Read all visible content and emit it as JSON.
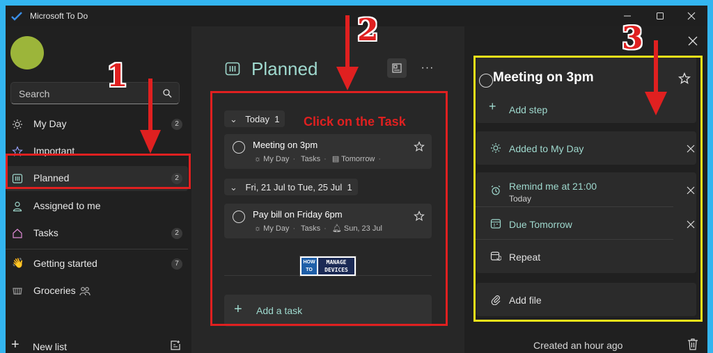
{
  "app": {
    "title": "Microsoft To Do"
  },
  "sidebar": {
    "search_placeholder": "Search",
    "items": [
      {
        "label": "My Day",
        "count": "2",
        "icon": "sun-icon"
      },
      {
        "label": "Important",
        "count": "",
        "icon": "star-icon"
      },
      {
        "label": "Planned",
        "count": "2",
        "icon": "calendar-grid-icon"
      },
      {
        "label": "Assigned to me",
        "count": "",
        "icon": "person-icon"
      },
      {
        "label": "Tasks",
        "count": "2",
        "icon": "home-icon"
      },
      {
        "label": "Getting started",
        "count": "7",
        "icon": "waving-hand-icon"
      },
      {
        "label": "Groceries",
        "count": "",
        "icon": "grocery-icon"
      }
    ],
    "new_list_label": "New list"
  },
  "main": {
    "title": "Planned",
    "groups": [
      {
        "label": "Today",
        "count": "1",
        "tasks": [
          {
            "title": "Meeting on 3pm",
            "meta": [
              "My Day",
              "Tasks",
              "Tomorrow"
            ]
          }
        ]
      },
      {
        "label": "Fri, 21 Jul to Tue, 25 Jul",
        "count": "1",
        "tasks": [
          {
            "title": "Pay bill on Friday 6pm",
            "meta": [
              "My Day",
              "Tasks",
              "Sun, 23 Jul"
            ]
          }
        ]
      }
    ],
    "add_task_label": "Add a task",
    "callout": "Click on the Task",
    "logo": {
      "top_left": "HOW TO",
      "top_right": "MANAGE DEVICES"
    }
  },
  "detail": {
    "title": "Meeting on 3pm",
    "add_step": "Add step",
    "added_to_my_day": "Added to My Day",
    "remind_label": "Remind me at 21:00",
    "remind_sub": "Today",
    "due_label": "Due Tomorrow",
    "repeat_label": "Repeat",
    "add_file_label": "Add file",
    "created": "Created an hour ago"
  },
  "annotations": {
    "step1": "1",
    "step2": "2",
    "step3": "3"
  },
  "colors": {
    "accent": "#9fd9ce",
    "callout_red": "#e02020",
    "highlight_yellow": "#f2e21a",
    "frame": "#33b5f0"
  }
}
